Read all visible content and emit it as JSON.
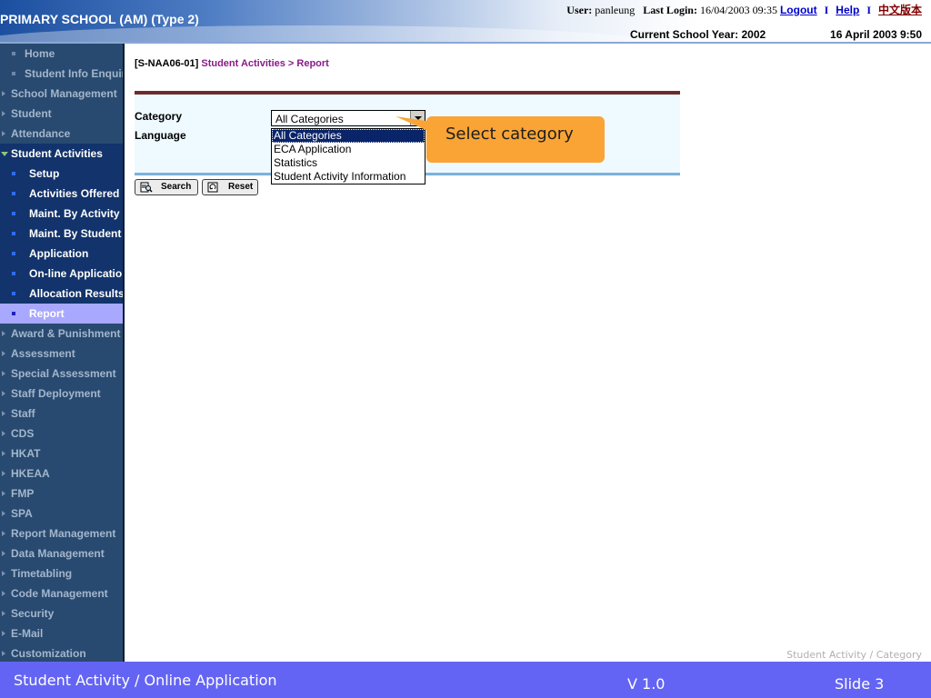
{
  "header": {
    "school_title": "PRIMARY SCHOOL (AM) (Type 2)",
    "user_label": "User:",
    "user_name": "panleung",
    "last_login_label": "Last Login:",
    "last_login_value": "16/04/2003 09:35",
    "logout_label": "Logout",
    "help_label": "Help",
    "separator": "I",
    "chinese_version_label": "中文版本",
    "school_year": "Current School Year: 2002",
    "date_time": "16 April 2003 9:50"
  },
  "sidebar": {
    "items": [
      {
        "label": "Home"
      },
      {
        "label": "Student Info Enquiry"
      },
      {
        "label": "School Management"
      },
      {
        "label": "Student"
      },
      {
        "label": "Attendance"
      },
      {
        "label": "Student Activities"
      },
      {
        "label": "Setup"
      },
      {
        "label": "Activities Offered"
      },
      {
        "label": "Maint. By Activity"
      },
      {
        "label": "Maint. By Student"
      },
      {
        "label": "Application"
      },
      {
        "label": "On-line Application"
      },
      {
        "label": "Allocation Results"
      },
      {
        "label": "Report"
      },
      {
        "label": "Award & Punishment"
      },
      {
        "label": "Assessment"
      },
      {
        "label": "Special Assessment"
      },
      {
        "label": "Staff Deployment"
      },
      {
        "label": "Staff"
      },
      {
        "label": "CDS"
      },
      {
        "label": "HKAT"
      },
      {
        "label": "HKEAA"
      },
      {
        "label": "FMP"
      },
      {
        "label": "SPA"
      },
      {
        "label": "Report Management"
      },
      {
        "label": "Data Management"
      },
      {
        "label": "Timetabling"
      },
      {
        "label": "Code Management"
      },
      {
        "label": "Security"
      },
      {
        "label": "E-Mail"
      },
      {
        "label": "Customization"
      }
    ]
  },
  "main": {
    "breadcrumb_code": "[S-NAA06-01]",
    "breadcrumb_section": "Student Activities",
    "breadcrumb_sep": " > ",
    "breadcrumb_page": "Report",
    "category_label": "Category",
    "language_label": "Language",
    "category_selected": "All Categories",
    "category_options": [
      "All Categories",
      "ECA Application",
      "Statistics",
      "Student Activity Information"
    ],
    "search_label": "Search",
    "reset_label": "Reset"
  },
  "callout": {
    "text": "Select category",
    "color": "#f9a435"
  },
  "slide": {
    "caption": "Student Activity / Category",
    "footer_title": "Student Activity / Online Application",
    "version": "V 1.0",
    "slide_number": "Slide 3",
    "footer_color": "#6464f4"
  }
}
